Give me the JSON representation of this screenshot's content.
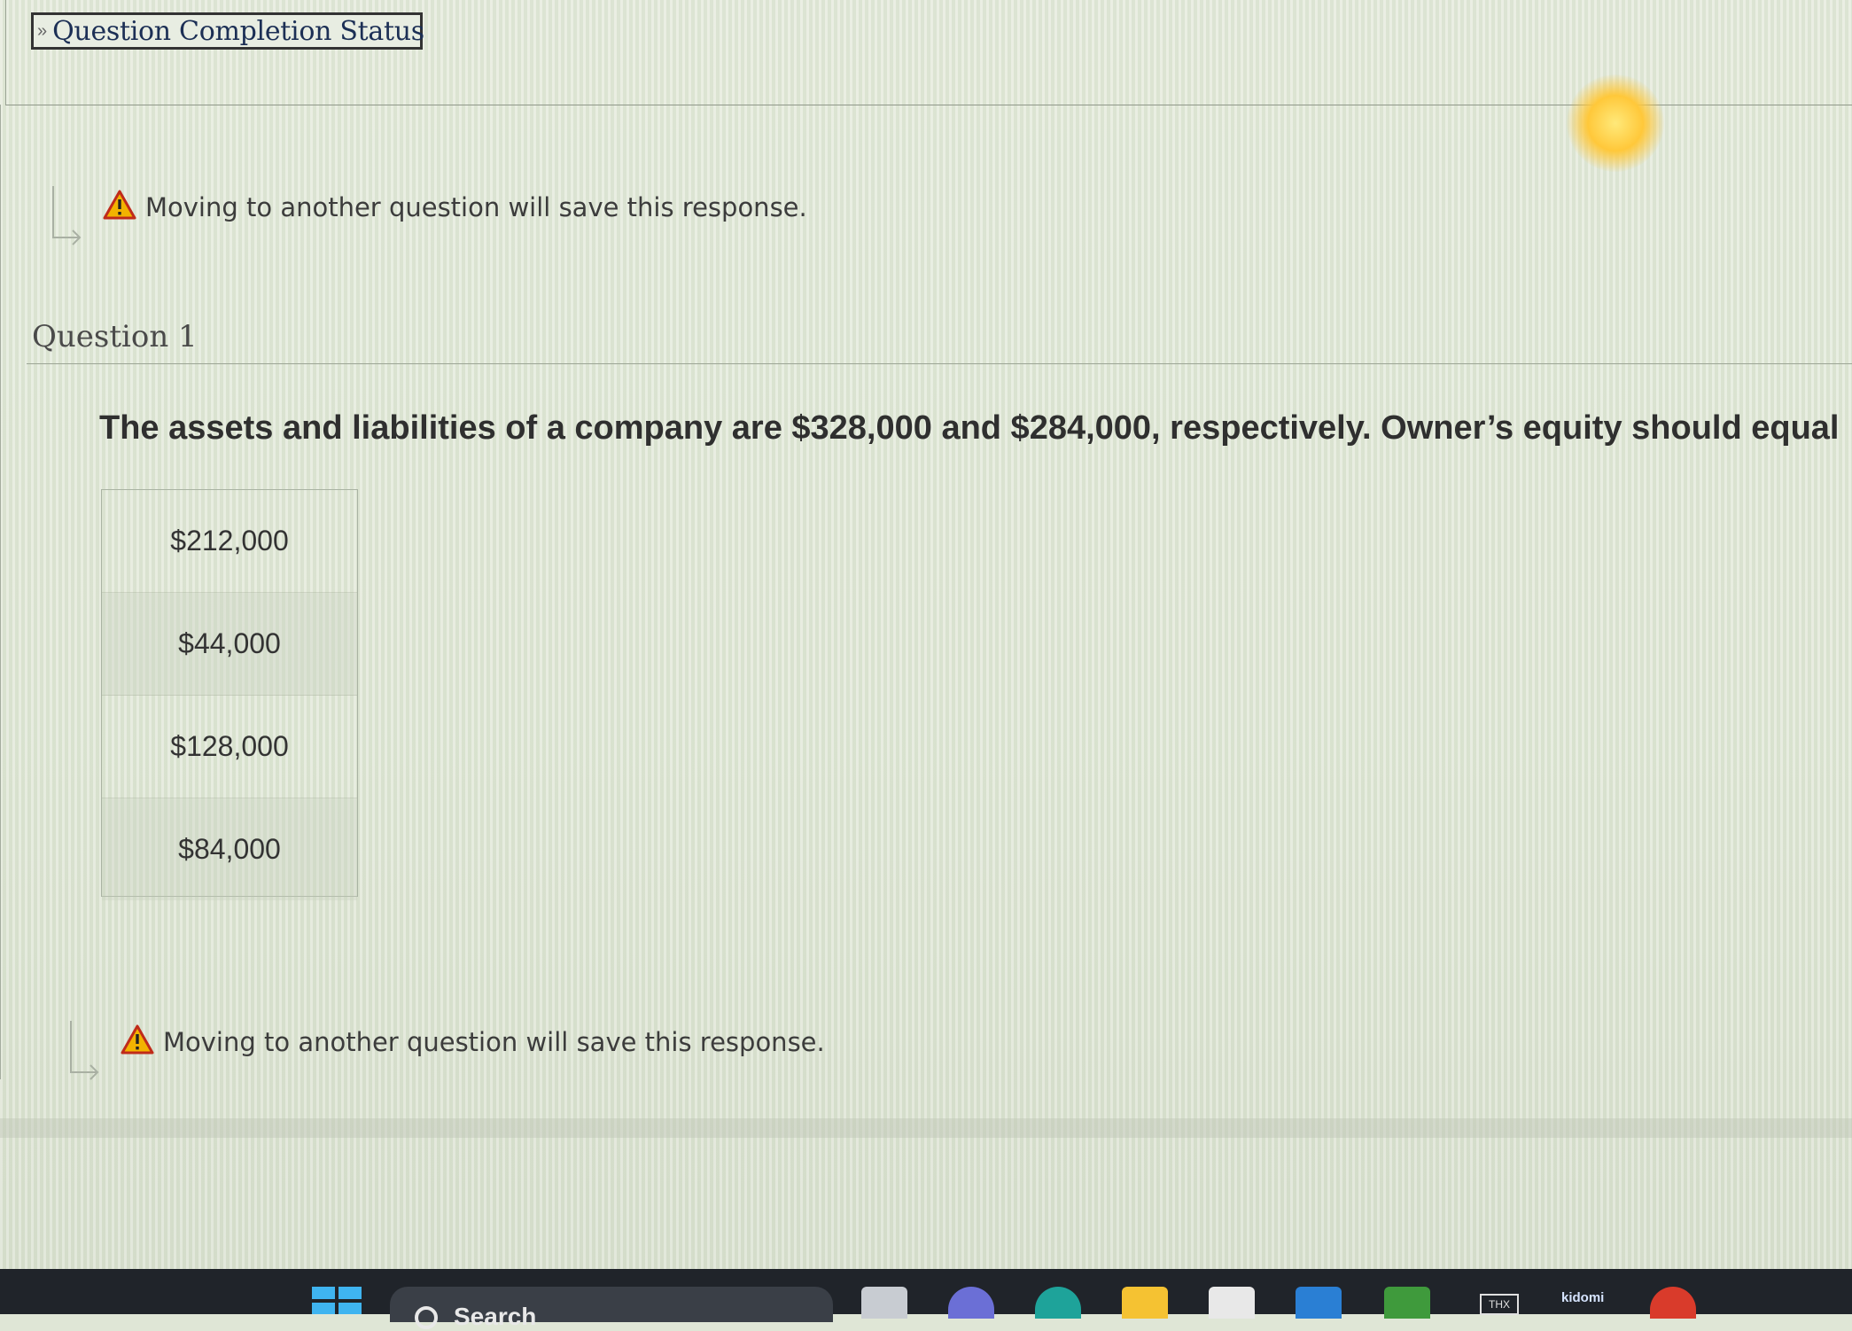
{
  "completion": {
    "label": "Question Completion Status"
  },
  "warnings": {
    "top": "Moving to another question will save this response.",
    "bottom": "Moving to another question will save this response."
  },
  "question": {
    "title": "Question 1",
    "text": "The assets and liabilities of a company are $328,000 and $284,000, respectively.  Owner’s equity should equal",
    "options": [
      "$212,000",
      "$44,000",
      "$128,000",
      "$84,000"
    ]
  },
  "taskbar": {
    "search_label": "Search",
    "apps": [
      "file-explorer-icon",
      "teams-icon",
      "edge-icon",
      "folder-icon",
      "store-icon",
      "mail-icon",
      "solitaire-icon",
      "thx-icon",
      "kidomi-icon",
      "chrome-icon"
    ],
    "kidomi_label": "kidomi",
    "thx_label": "THX"
  },
  "colors": {
    "warning": "#f2b300",
    "taskbar": "#20242a",
    "link": "#1c2f55"
  }
}
